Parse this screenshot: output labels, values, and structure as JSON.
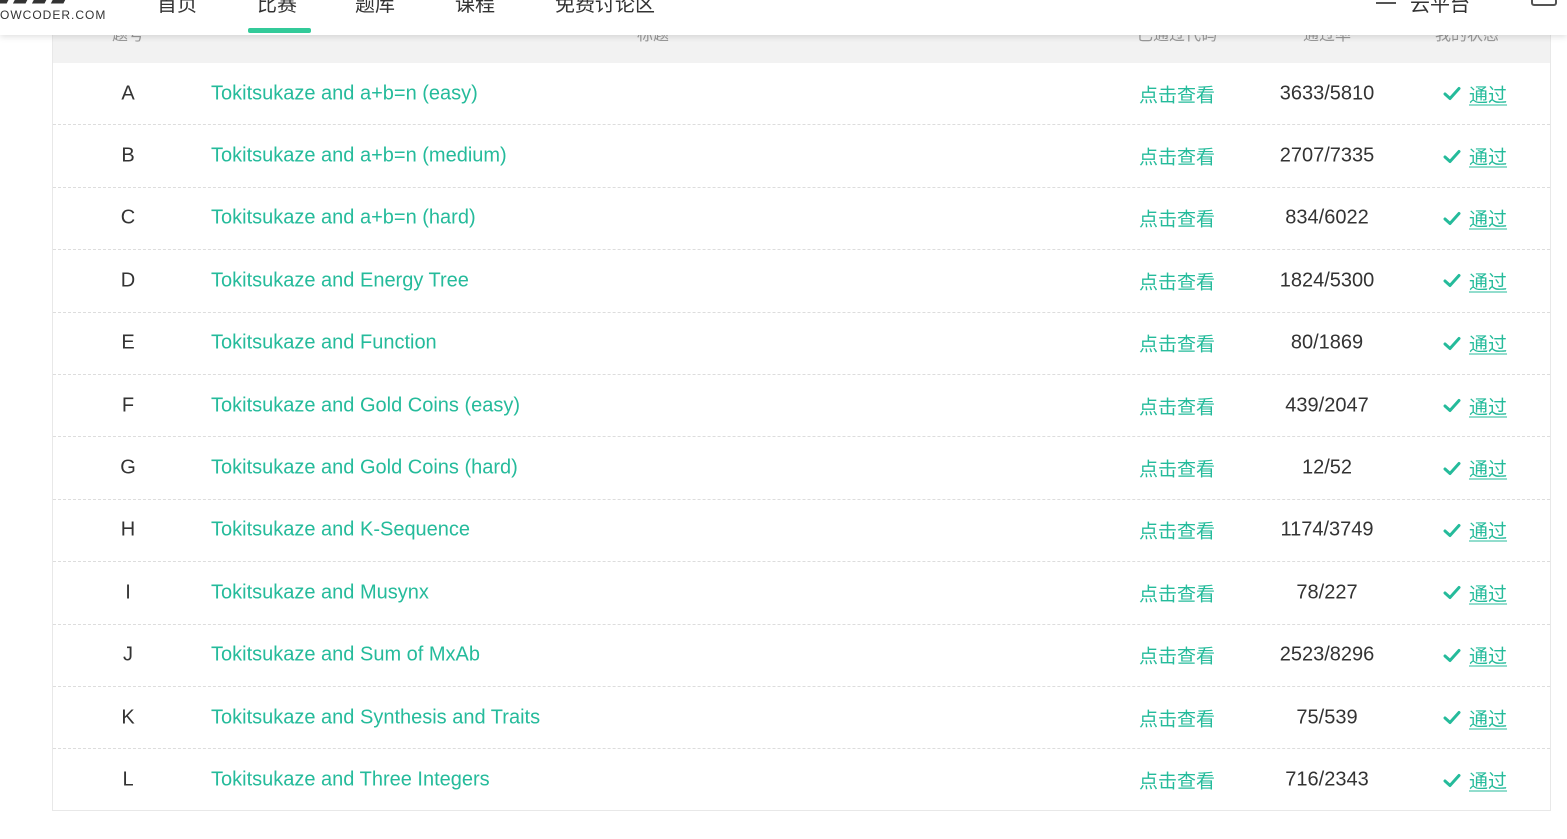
{
  "header": {
    "logo_sub": "OWCODER.COM",
    "nav": [
      "首页",
      "比赛",
      "题库",
      "课程",
      "免费讨论区"
    ],
    "active_nav_index": 1,
    "right_nav_label": "云平台",
    "accent_color": "#32ca99"
  },
  "table": {
    "columns": [
      "题号",
      "标题",
      "已通过代码",
      "通过率",
      "我的状态"
    ],
    "link_color": "#25bb9b",
    "rows": [
      {
        "id": "A",
        "title": "Tokitsukaze and a+b=n (easy)",
        "code": "点击查看",
        "rate": "3633/5810",
        "status": "通过"
      },
      {
        "id": "B",
        "title": "Tokitsukaze and a+b=n (medium)",
        "code": "点击查看",
        "rate": "2707/7335",
        "status": "通过"
      },
      {
        "id": "C",
        "title": "Tokitsukaze and a+b=n (hard)",
        "code": "点击查看",
        "rate": "834/6022",
        "status": "通过"
      },
      {
        "id": "D",
        "title": "Tokitsukaze and Energy Tree",
        "code": "点击查看",
        "rate": "1824/5300",
        "status": "通过"
      },
      {
        "id": "E",
        "title": "Tokitsukaze and Function",
        "code": "点击查看",
        "rate": "80/1869",
        "status": "通过"
      },
      {
        "id": "F",
        "title": "Tokitsukaze and Gold Coins (easy)",
        "code": "点击查看",
        "rate": "439/2047",
        "status": "通过"
      },
      {
        "id": "G",
        "title": "Tokitsukaze and Gold Coins (hard)",
        "code": "点击查看",
        "rate": "12/52",
        "status": "通过"
      },
      {
        "id": "H",
        "title": "Tokitsukaze and K-Sequence",
        "code": "点击查看",
        "rate": "1174/3749",
        "status": "通过"
      },
      {
        "id": "I",
        "title": "Tokitsukaze and Musynx",
        "code": "点击查看",
        "rate": "78/227",
        "status": "通过"
      },
      {
        "id": "J",
        "title": "Tokitsukaze and Sum of MxAb",
        "code": "点击查看",
        "rate": "2523/8296",
        "status": "通过"
      },
      {
        "id": "K",
        "title": "Tokitsukaze and Synthesis and Traits",
        "code": "点击查看",
        "rate": "75/539",
        "status": "通过"
      },
      {
        "id": "L",
        "title": "Tokitsukaze and Three Integers",
        "code": "点击查看",
        "rate": "716/2343",
        "status": "通过"
      }
    ]
  }
}
